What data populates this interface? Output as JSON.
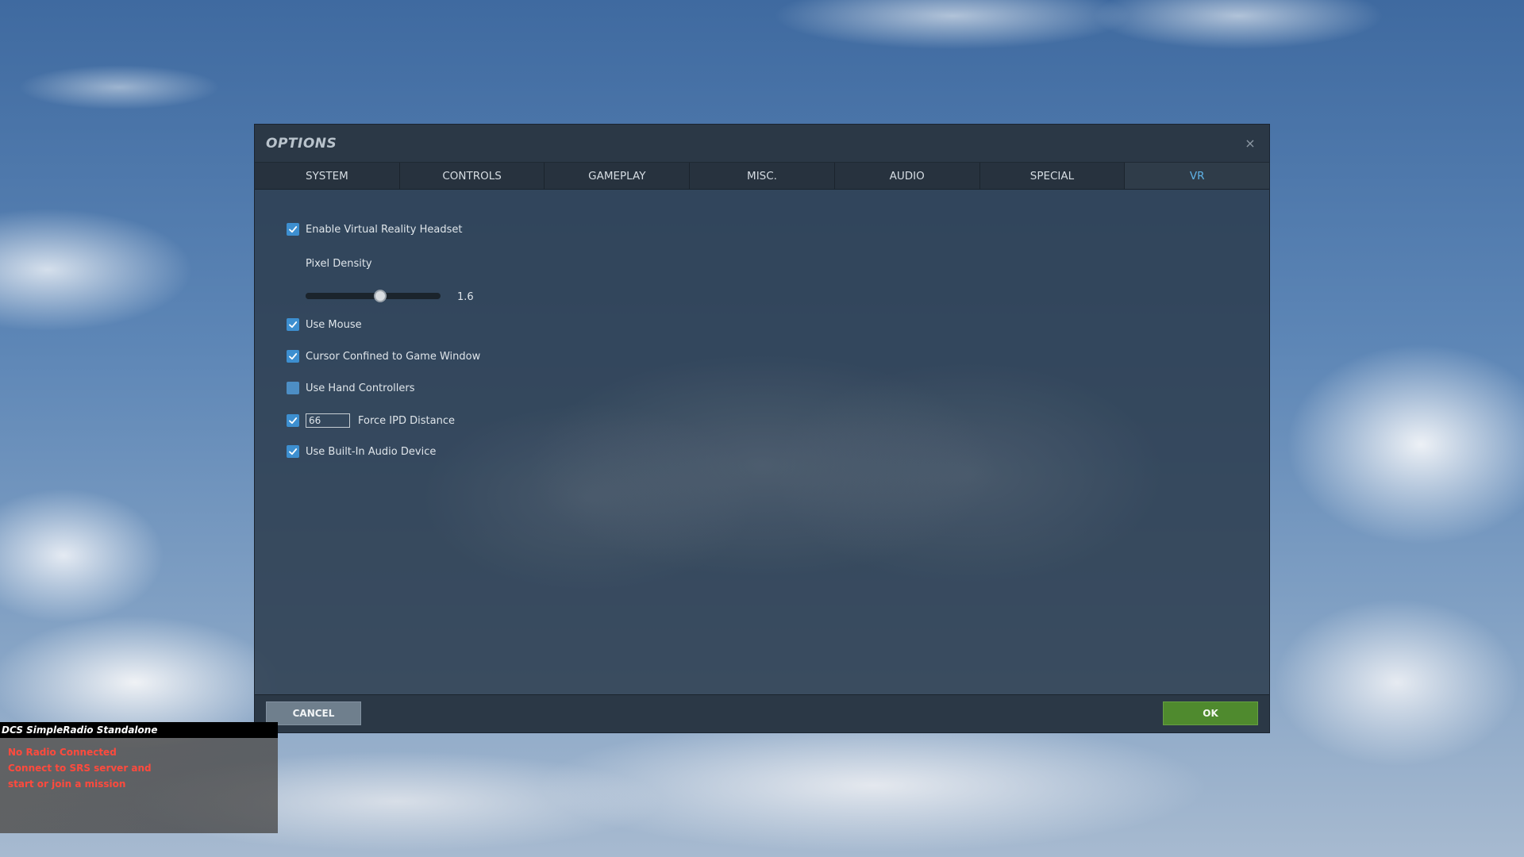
{
  "dialog": {
    "title": "OPTIONS",
    "close_glyph": "×"
  },
  "tabs": [
    {
      "label": "SYSTEM",
      "active": false
    },
    {
      "label": "CONTROLS",
      "active": false
    },
    {
      "label": "GAMEPLAY",
      "active": false
    },
    {
      "label": "MISC.",
      "active": false
    },
    {
      "label": "AUDIO",
      "active": false
    },
    {
      "label": "SPECIAL",
      "active": false
    },
    {
      "label": "VR",
      "active": true
    }
  ],
  "vr": {
    "enable_vr": {
      "label": "Enable Virtual Reality Headset",
      "checked": true
    },
    "pixel_density": {
      "label": "Pixel Density",
      "value": "1.6",
      "fraction": 0.55
    },
    "use_mouse": {
      "label": "Use Mouse",
      "checked": true
    },
    "cursor_confined": {
      "label": "Cursor Confined to Game Window",
      "checked": true
    },
    "hand_controllers": {
      "label": "Use Hand Controllers",
      "checked": false
    },
    "force_ipd": {
      "label": "Force IPD Distance",
      "checked": true,
      "value": "66"
    },
    "builtin_audio": {
      "label": "Use Built-In Audio Device",
      "checked": true
    }
  },
  "footer": {
    "cancel_label": "CANCEL",
    "ok_label": "OK"
  },
  "srs": {
    "title": "DCS SimpleRadio Standalone",
    "lines": [
      "No Radio Connected",
      "Connect to SRS server and",
      "start or join a mission"
    ],
    "line_color": "#ff4a3d"
  },
  "colors": {
    "accent_tab": "#5fb2e6",
    "checkbox": "#3d8fd0",
    "ok_button": "#4f8a2e",
    "cancel_button": "#6f7f8d"
  }
}
